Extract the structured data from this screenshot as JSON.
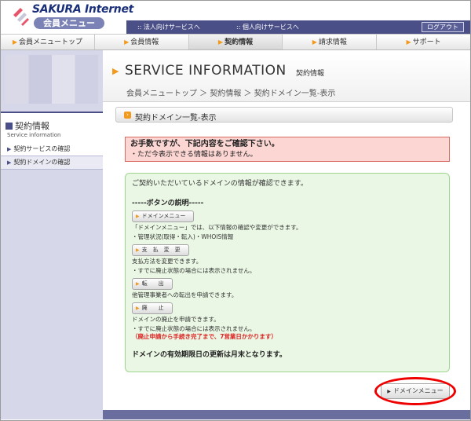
{
  "header": {
    "logo_text": "SAKURA Internet",
    "logo_sub": "会員メニュー",
    "link_corporate": ":: 法人向けサービスへ",
    "link_personal": ":: 個人向けサービスへ",
    "logout_label": "ログアウト"
  },
  "nav": {
    "items": [
      {
        "label": "会員メニュートップ"
      },
      {
        "label": "会員情報"
      },
      {
        "label": "契約情報"
      },
      {
        "label": "請求情報"
      },
      {
        "label": "サポート"
      }
    ]
  },
  "sidebar": {
    "title": "契約情報",
    "title_en": "Service information",
    "items": [
      {
        "label": "契約サービスの確認"
      },
      {
        "label": "契約ドメインの確認"
      }
    ]
  },
  "main": {
    "service_title": "SERVICE INFORMATION",
    "service_sub": "契約情報",
    "breadcrumb": "会員メニュートップ ＞ 契約情報 ＞ 契約ドメイン一覧-表示",
    "section_title": "契約ドメイン一覧-表示",
    "alert_title": "お手数ですが、下記内容をご確認下さい。",
    "alert_body": "・ただ今表示できる情報はありません。",
    "info_intro": "ご契約いただいているドメインの情報が確認できます。",
    "info_heading": "-----ボタンの説明-----",
    "btn_domain_menu": "ドメインメニュー",
    "desc_domain_menu_1": "「ドメインメニュー」では、以下情報の確認や変更ができます。",
    "desc_domain_menu_2": "・管理状況(取得・転入)・WHOIS情報",
    "btn_payment": "支　払　変　更",
    "desc_payment_1": "支払方法を変更できます。",
    "desc_payment_2": "・すでに廃止状態の場合には表示されません。",
    "btn_transfer": "転　　出",
    "desc_transfer": "他管理事業者への転出を申請できます。",
    "btn_abolish": "廃　　止",
    "desc_abolish_1": "ドメインの廃止を申請できます。",
    "desc_abolish_2": "・すでに廃止状態の場合には表示されません。",
    "desc_abolish_red": "（廃止申請から手続き完了まで、7営業日かかります）",
    "info_footer": "ドメインの有効期限日の更新は月末となります。",
    "domain_menu_button": "ドメインメニュー"
  },
  "colors": {
    "brand": "#4b4f87",
    "accent": "#f29a1e",
    "alert_bg": "#fcd6d3",
    "info_bg": "#eaf7e4",
    "highlight_circle": "#e00000"
  }
}
